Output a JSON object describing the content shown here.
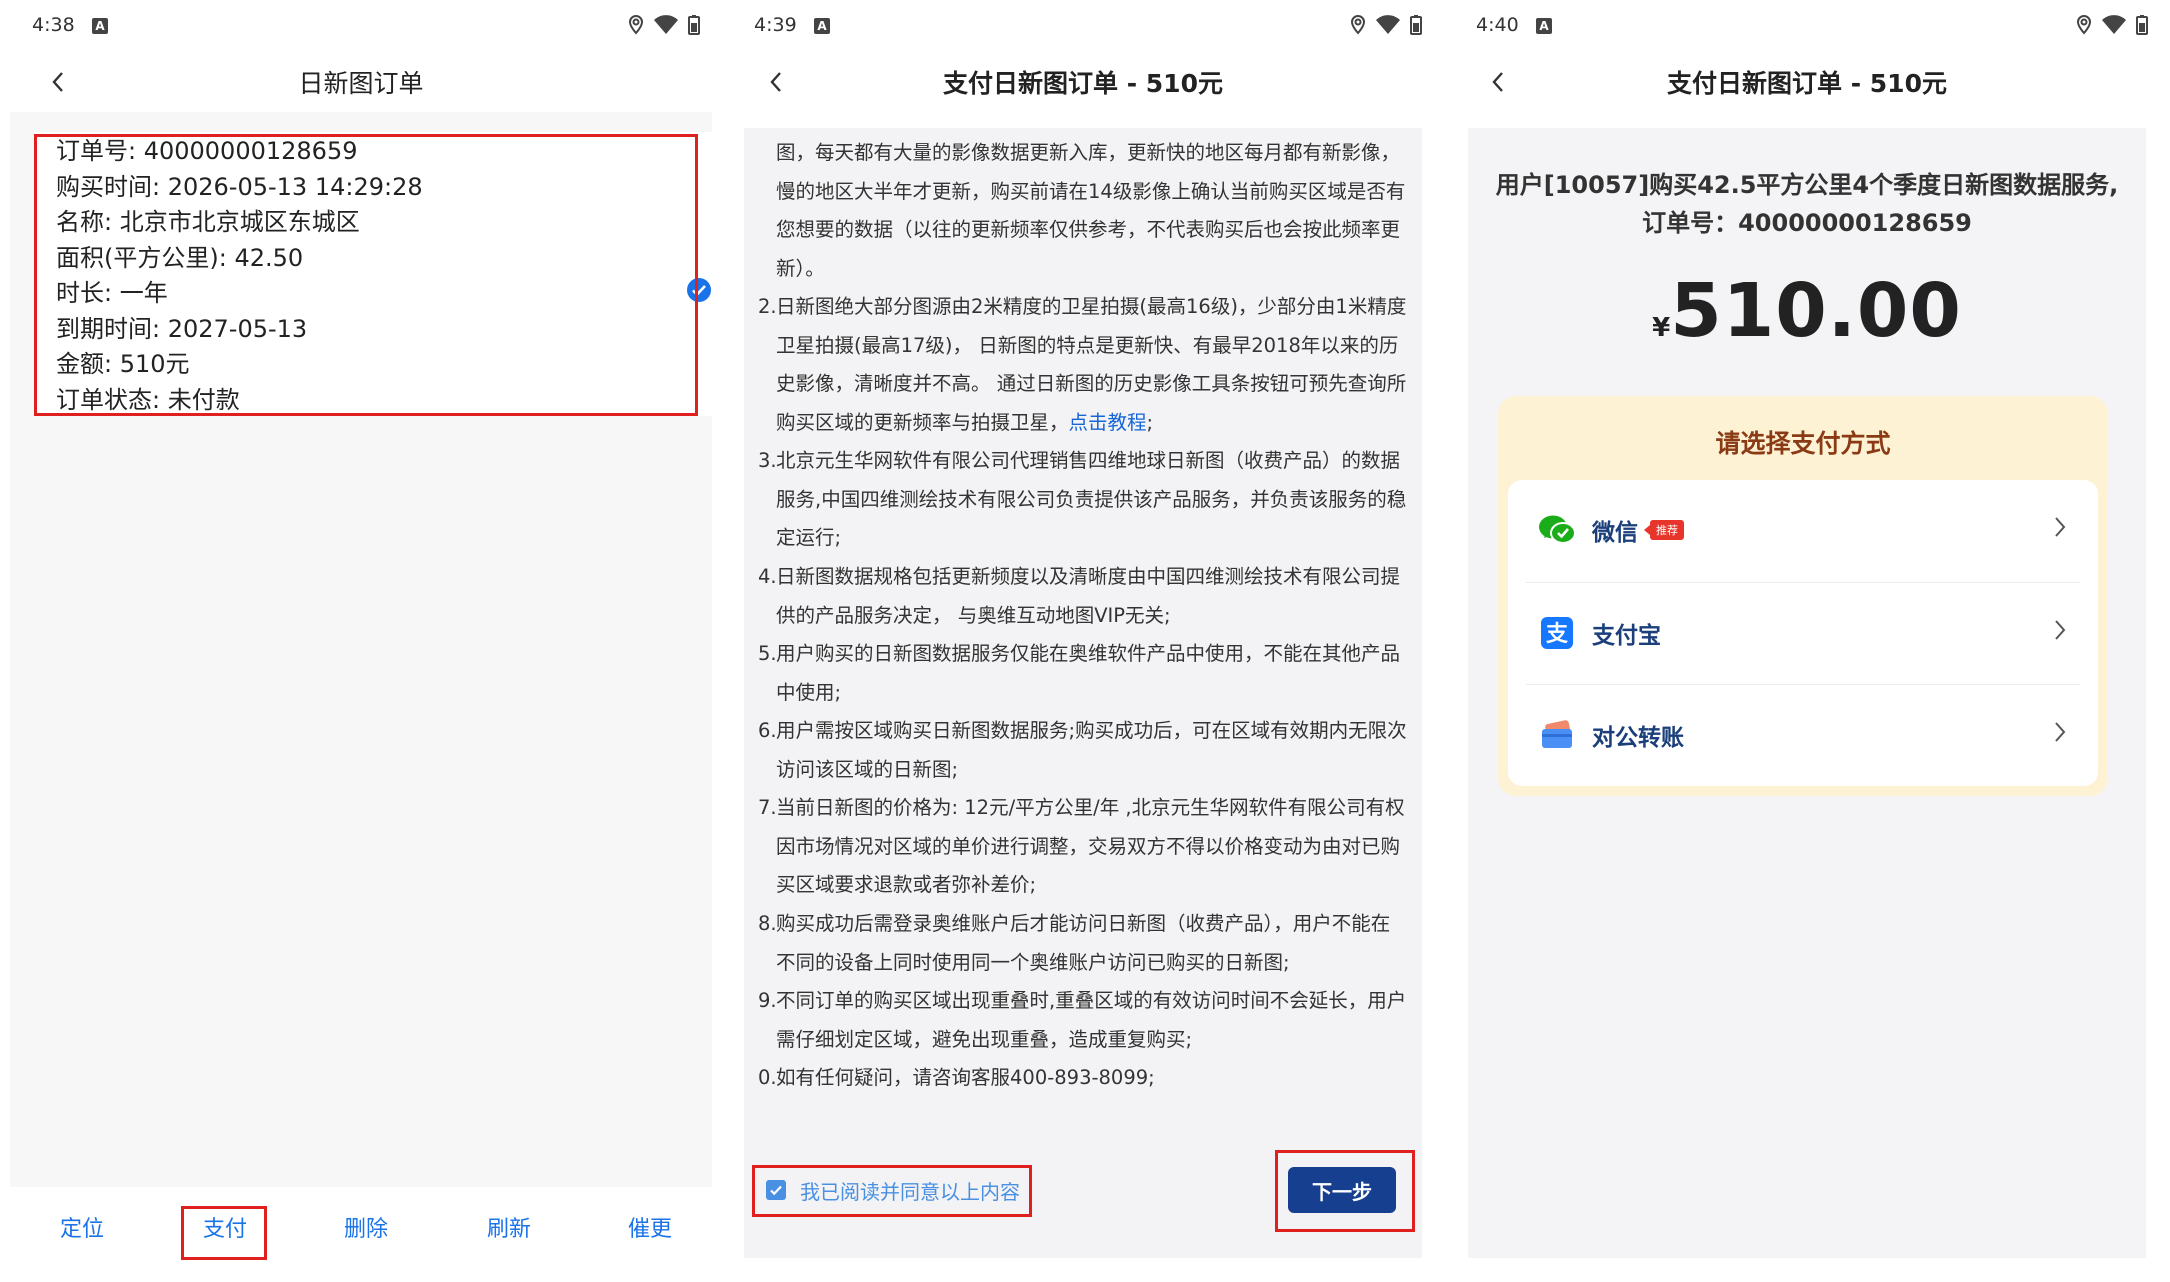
{
  "screens": [
    {
      "status_time": "4:38",
      "title": "日新图订单",
      "order_lines": [
        "订单号: 40000000128659",
        "购买时间: 2026-05-13 14:29:28",
        "名称: 北京市北京城区东城区",
        "面积(平方公里): 42.50",
        "时长: 一年",
        "到期时间: 2027-05-13",
        "金额: 510元",
        "订单状态: 未付款"
      ],
      "actions": [
        "定位",
        "支付",
        "删除",
        "刷新",
        "催更"
      ]
    },
    {
      "status_time": "4:39",
      "title": "支付日新图订单 - 510元",
      "terms": [
        {
          "num": "",
          "text": "图，每天都有大量的影像数据更新入库，更新快的地区每月都有新影像，慢的地区大半年才更新，购买前请在14级影像上确认当前购买区域是否有您想要的数据（以往的更新频率仅供参考，不代表购买后也会按此频率更新）。"
        },
        {
          "num": "2.",
          "text": "日新图绝大部分图源由2米精度的卫星拍摄(最高16级)，少部分由1米精度卫星拍摄(最高17级)， 日新图的特点是更新快、有最早2018年以来的历史影像，清晰度并不高。 通过日新图的历史影像工具条按钮可预先查询所购买区域的更新频率与拍摄卫星，",
          "link": "点击教程",
          "after": ";"
        },
        {
          "num": "3.",
          "text": "北京元生华网软件有限公司代理销售四维地球日新图（收费产品）的数据服务,中国四维测绘技术有限公司负责提供该产品服务，并负责该服务的稳定运行;"
        },
        {
          "num": "4.",
          "text": "日新图数据规格包括更新频度以及清晰度由中国四维测绘技术有限公司提供的产品服务决定， 与奥维互动地图VIP无关;"
        },
        {
          "num": "5.",
          "text": "用户购买的日新图数据服务仅能在奥维软件产品中使用，不能在其他产品中使用;"
        },
        {
          "num": "6.",
          "text": "用户需按区域购买日新图数据服务;购买成功后，可在区域有效期内无限次访问该区域的日新图;"
        },
        {
          "num": "7.",
          "text": "当前日新图的价格为: 12元/平方公里/年 ,北京元生华网软件有限公司有权因市场情况对区域的单价进行调整，交易双方不得以价格变动为由对已购买区域要求退款或者弥补差价;"
        },
        {
          "num": "8.",
          "text": "购买成功后需登录奥维账户后才能访问日新图（收费产品），用户不能在不同的设备上同时使用同一个奥维账户访问已购买的日新图;"
        },
        {
          "num": "9.",
          "text": "不同订单的购买区域出现重叠时,重叠区域的有效访问时间不会延长，用户需仔细划定区域，避免出现重叠，造成重复购买;"
        },
        {
          "num": "0.",
          "text": "如有任何疑问，请咨询客服400-893-8099;"
        }
      ],
      "agree_label": "我已阅读并同意以上内容",
      "next_label": "下一步"
    },
    {
      "status_time": "4:40",
      "title": "支付日新图订单 - 510元",
      "desc_line1": "用户[10057]购买42.5平方公里4个季度日新图数据服务,",
      "desc_line2": "订单号：40000000128659",
      "currency": "¥",
      "amount": "510.00",
      "pay_title": "请选择支付方式",
      "pay_methods": [
        {
          "label": "微信",
          "badge": "推荐",
          "icon": "wechat-icon"
        },
        {
          "label": "支付宝",
          "badge": "",
          "icon": "alipay-icon"
        },
        {
          "label": "对公转账",
          "badge": "",
          "icon": "bank-card-icon"
        }
      ]
    }
  ],
  "colors": {
    "accent_blue": "#1a73e8",
    "highlight_red": "#e0201f",
    "next_button": "#173f8f",
    "pay_box_bg": "#fdf2d3",
    "pay_title": "#8a3a14"
  }
}
